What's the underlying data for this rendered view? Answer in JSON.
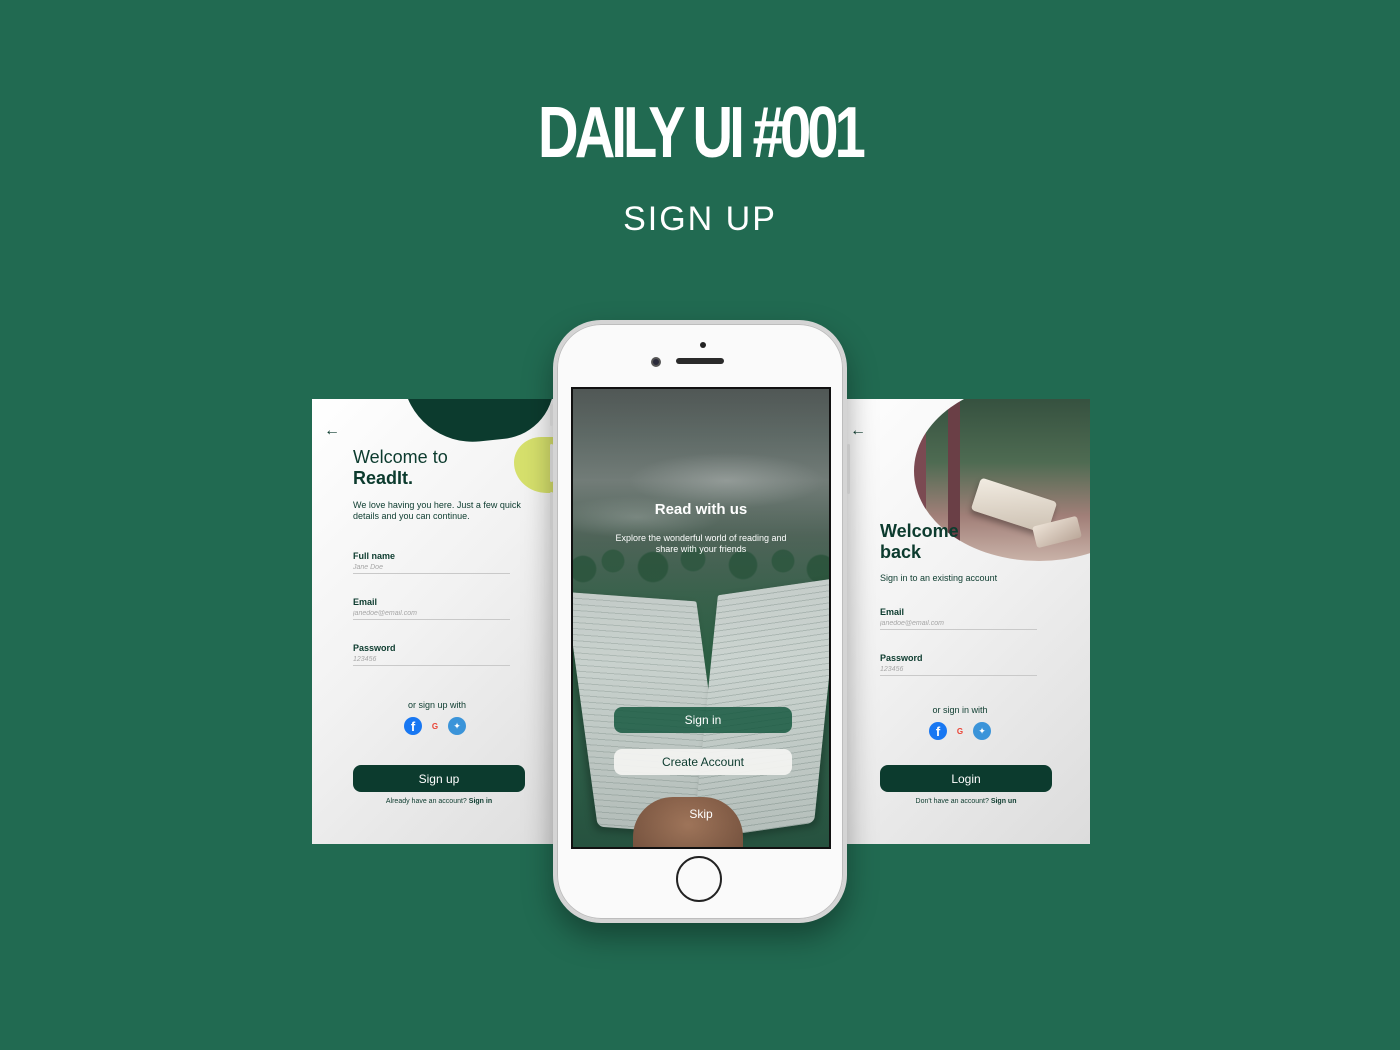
{
  "header": {
    "title": "DAILY UI #001",
    "subtitle": "SIGN UP"
  },
  "signup_screen": {
    "welcome_line1": "Welcome to",
    "welcome_line2": "ReadIt.",
    "intro": "We love having you here. Just a few quick details and you can continue.",
    "fields": [
      {
        "label": "Full name",
        "placeholder": "Jane Doe"
      },
      {
        "label": "Email",
        "placeholder": "janedoe@email.com"
      },
      {
        "label": "Password",
        "placeholder": "123456"
      }
    ],
    "social_label": "or sign up with",
    "button_label": "Sign up",
    "footer_prefix": "Already have an account?",
    "footer_link": "Sign in"
  },
  "splash_screen": {
    "title": "Read with us",
    "subtitle": "Explore the wonderful world of reading and share with your friends",
    "signin_label": "Sign in",
    "create_label": "Create Account",
    "skip_label": "Skip"
  },
  "login_screen": {
    "welcome_line1": "Welcome",
    "welcome_line2": "back",
    "intro": "Sign in to an existing account",
    "fields": [
      {
        "label": "Email",
        "placeholder": "janedoe@email.com"
      },
      {
        "label": "Password",
        "placeholder": "123456"
      }
    ],
    "social_label": "or sign in with",
    "button_label": "Login",
    "footer_prefix": "Don't have an account?",
    "footer_link": "Sign un"
  },
  "icons": {
    "back": "arrow-left-icon",
    "facebook": "facebook-icon",
    "google": "google-icon",
    "twitter": "twitter-icon"
  },
  "colors": {
    "background": "#216a51",
    "primary": "#0c3b2e",
    "accent_yellow": "#d6e06c",
    "white": "#ffffff"
  }
}
